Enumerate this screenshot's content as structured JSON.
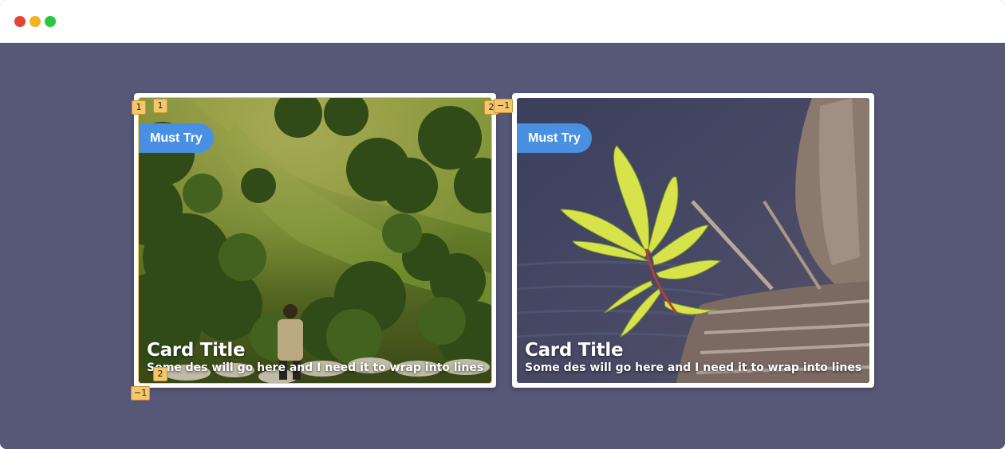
{
  "window": {
    "controls": [
      "close",
      "minimize",
      "maximize"
    ],
    "colors": {
      "close": "#e0443a",
      "minimize": "#f0b323",
      "maximize": "#28c940",
      "background": "#575777"
    }
  },
  "cards": [
    {
      "badge": "Must Try",
      "title": "Card Title",
      "description": "Some des will go here and I need it to wrap into lines",
      "image": "forest-hillside-shepherd-sheep"
    },
    {
      "badge": "Must Try",
      "title": "Card Title",
      "description": "Some des will go here and I need it to wrap into lines",
      "image": "green-sprout-on-wooden-log"
    }
  ],
  "markers": {
    "top_left_outer": "1",
    "top_left_inner": "1",
    "top_right_inner": "2",
    "top_right_outer": "−1",
    "bottom_left_inner": "2",
    "bottom_left_outer": "−1"
  },
  "accent_color": "#4a90e2"
}
